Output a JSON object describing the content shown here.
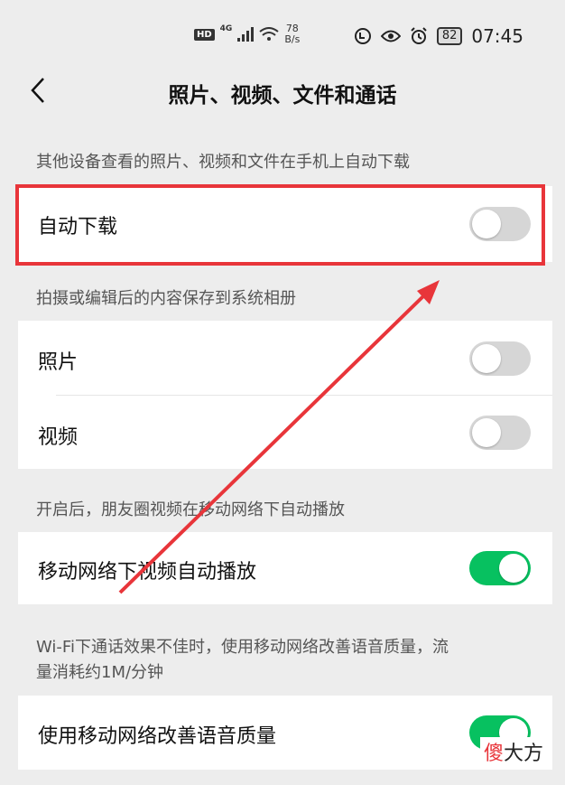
{
  "status_bar": {
    "hd": "HD",
    "network": "4G",
    "speed_value": "78",
    "speed_unit": "B/s",
    "battery": "82",
    "time": "07:45"
  },
  "header": {
    "title": "照片、视频、文件和通话"
  },
  "sections": [
    {
      "description": "其他设备查看的照片、视频和文件在手机上自动下载",
      "items": [
        {
          "label": "自动下载",
          "enabled": false
        }
      ]
    },
    {
      "description": "拍摄或编辑后的内容保存到系统相册",
      "items": [
        {
          "label": "照片",
          "enabled": false
        },
        {
          "label": "视频",
          "enabled": false
        }
      ]
    },
    {
      "description": "开启后，朋友圈视频在移动网络下自动播放",
      "items": [
        {
          "label": "移动网络下视频自动播放",
          "enabled": true
        }
      ]
    },
    {
      "description_line1": "Wi-Fi下通话效果不佳时，使用移动网络改善语音质量，流",
      "description_line2": "量消耗约1M/分钟",
      "items": [
        {
          "label": "使用移动网络改善语音质量",
          "enabled": true
        }
      ]
    }
  ],
  "watermark": {
    "first": "傻",
    "rest": "大方"
  },
  "colors": {
    "toggle_on": "#07c160",
    "toggle_off": "#d6d6d6",
    "highlight": "#e8353a",
    "background": "#ededed"
  },
  "icons": [
    "eye-comfort-icon",
    "eye-icon",
    "alarm-icon",
    "wifi-icon",
    "signal-icon",
    "back-arrow-icon"
  ]
}
